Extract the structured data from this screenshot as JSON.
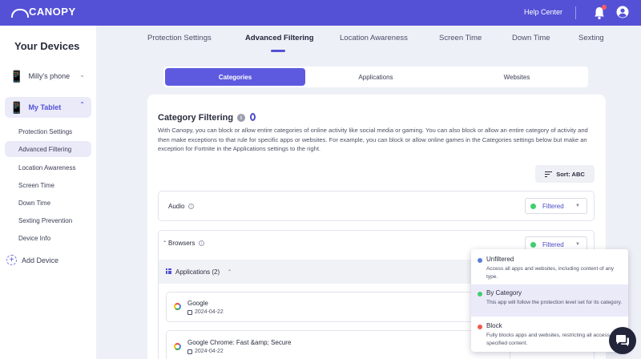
{
  "header": {
    "brand": "CANOPY",
    "help_center": "Help Center",
    "colors": {
      "bar": "#5451d6",
      "notification": "#ff5c5c"
    }
  },
  "sidebar": {
    "title": "Your Devices",
    "devices": [
      {
        "name": "Milly's phone",
        "expanded": false
      },
      {
        "name": "My Tablet",
        "expanded": true
      }
    ],
    "sub_items": [
      "Protection Settings",
      "Advanced Filtering",
      "Location Awareness",
      "Screen Time",
      "Down Time",
      "Sexting Prevention",
      "Device Info"
    ],
    "active_sub_item": "Advanced Filtering",
    "add_device": "Add Device"
  },
  "tabs": [
    "Protection Settings",
    "Advanced Filtering",
    "Location Awareness",
    "Screen Time",
    "Down Time",
    "Sexting"
  ],
  "active_tab": "Advanced Filtering",
  "segments": [
    "Categories",
    "Applications",
    "Websites"
  ],
  "active_segment": "Categories",
  "category_filtering": {
    "title": "Category Filtering",
    "description": "With Canopy, you can block or allow entire categories of online activity like social media or gaming. You can also block or allow an entire category of activity and then make exceptions to that rule for specific apps or websites. For example, you can block or allow online games in the Categories settings below but make an exception for Fortnite in the Applications settings to the right.",
    "sort_label": "Sort: ABC",
    "rows": [
      {
        "label": "Audio",
        "status": "Filtered",
        "status_color": "#3fcf6e"
      },
      {
        "label": "Browsers",
        "status": "Filtered",
        "status_color": "#3fcf6e",
        "expanded": true
      }
    ],
    "applications_header": "Applications (2)",
    "applications": [
      {
        "name": "Google",
        "date": "2024-04-22"
      },
      {
        "name": "Google Chrome: Fast &amp; Secure",
        "date": "2024-04-22"
      }
    ]
  },
  "status_menu": {
    "options": [
      {
        "label": "Unfiltered",
        "description": "Access all apps and websites, including content of any type.",
        "color": "#5b7fd6"
      },
      {
        "label": "By Category",
        "description": "This app will follow the protection level set for its category.",
        "color": "#3fcf6e",
        "selected": true
      },
      {
        "label": "Block",
        "description": "Fully blocks apps and websites, restricting all access to specified content.",
        "color": "#ef5b4c"
      }
    ]
  }
}
